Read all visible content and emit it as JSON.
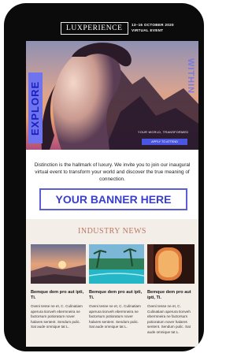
{
  "header": {
    "logo": "LUXPERIENCE",
    "event_dates": "13–16 OCTOBER 2020",
    "event_type": "VIRTUAL EVENT"
  },
  "hero": {
    "vertical_left": "EXPLORE",
    "vertical_right": "WITHIN",
    "tagline": "YOUR WORLD, TRANSFORMED",
    "cta": "APPLY TO ATTEND"
  },
  "intro": "Distinction is the hallmark of luxury. We invite you to join our inaugural virtual event to transform your world and discover the true meaning of connection.",
  "banner": "YOUR BANNER HERE",
  "news": {
    "title": "INDUSTRY NEWS",
    "items": [
      {
        "title": "Bemque dem pro aut ipti, Ti.",
        "body": "Oveni tesse ne et, C. Culinatiam aperura tionveh ebermneira ne factorsum potioratum nover halares sentent. Sendum pulic. Sat aude omnique tat L."
      },
      {
        "title": "Bemque dem pro aut ipti, Ti.",
        "body": "Oveni tesse ne et, C. Culinatiam aperura tionveh ebermneira ne factorsum potioratum nover halares sentent. Sendum pulic. Sat aude omnique tat L."
      },
      {
        "title": "Bemque dem pro aut ipti, Ti.",
        "body": "Oveni tesse ne et, C. Culinatiam aperura tionveh ebermneira ne factorsum potioratum nover halares sentent. Sendum pulic. Sat aude omnique tat L."
      }
    ]
  },
  "colors": {
    "header_bg": "#0b0b0b",
    "accent": "#4a55e0",
    "banner_text": "#3a3fc9",
    "news_bg": "#f4eee8",
    "news_title": "#b97762"
  }
}
